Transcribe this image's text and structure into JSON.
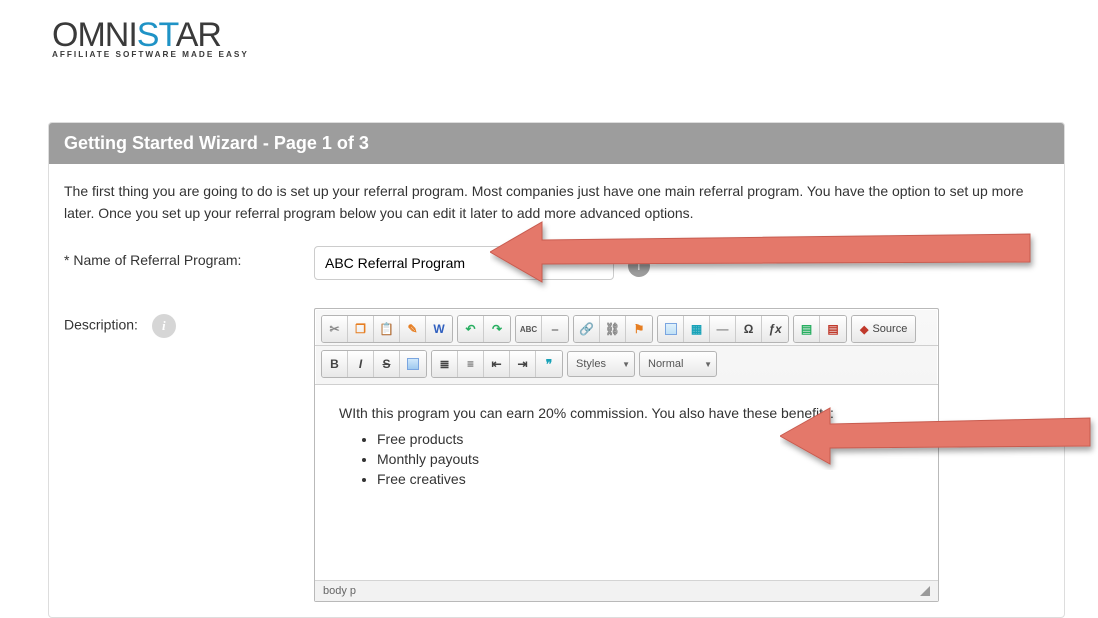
{
  "logo": {
    "part1": "OMNI",
    "part2": "ST",
    "part3": "AR",
    "tagline": "AFFILIATE SOFTWARE MADE EASY"
  },
  "panel": {
    "title": "Getting Started Wizard - Page 1 of 3",
    "intro": "The first thing you are going to do is set up your referral program. Most companies just have one main referral program. You have the option to set up more later. Once you set up your referral program below you can edit it later to add more advanced options."
  },
  "form": {
    "name_label": "* Name of Referral Program:",
    "name_value": "ABC Referral Program",
    "desc_label": "Description:",
    "info_glyph": "i"
  },
  "editor": {
    "content_paragraph": "WIth this program you can earn 20% commission. You also have these benefits:",
    "bullets": [
      "Free products",
      "Monthly payouts",
      "Free creatives"
    ],
    "styles_label": "Styles",
    "format_label": "Normal",
    "source_label": "Source",
    "path": "body   p",
    "tb": {
      "cut": "✂",
      "copy": "❐",
      "paste": "📋",
      "paste_text": "✎",
      "paste_word": "W",
      "undo": "↶",
      "redo": "↷",
      "spell": "ABC",
      "scayt": "⎯",
      "link": "🔗",
      "unlink": "⛓",
      "anchor": "⚑",
      "image": "▭",
      "table": "▦",
      "hr": "—",
      "special": "Ω",
      "math": "ƒx",
      "colors": "▤",
      "bold": "B",
      "italic": "I",
      "strike": "S",
      "rformat": "⨯",
      "ul": "≣",
      "ol": "≡",
      "outdent": "⇤",
      "indent": "⇥",
      "quote": "❞"
    }
  }
}
